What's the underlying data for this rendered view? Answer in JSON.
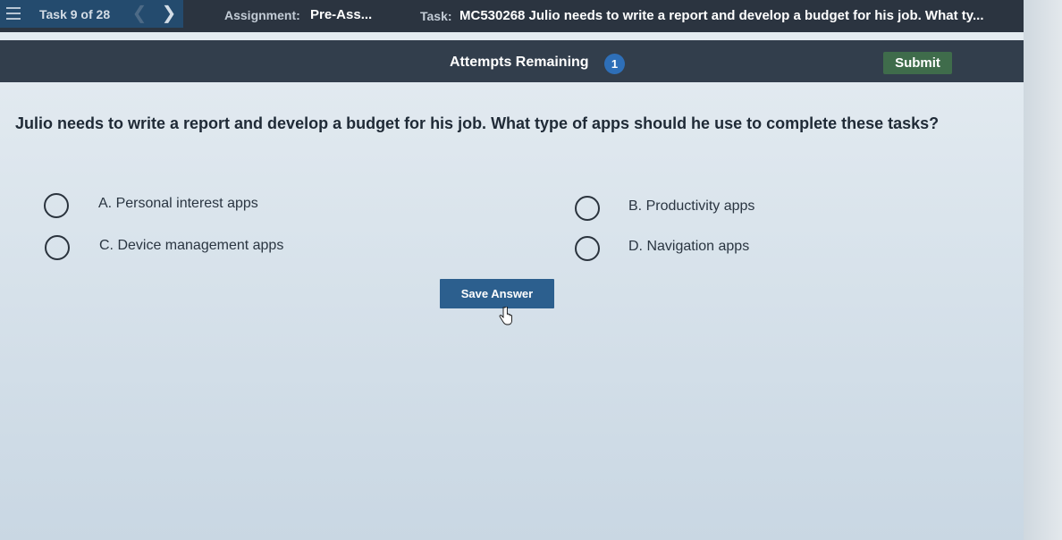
{
  "header": {
    "task_counter": "Task 9 of 28",
    "assignment_label": "Assignment:",
    "assignment_value": "Pre-Ass...",
    "task_label": "Task:",
    "task_value": "MC530268 Julio needs to write a report and develop a budget for his job. What ty...",
    "nav_prev_icon": "chevron-left-icon",
    "nav_next_icon": "chevron-right-icon",
    "menu_icon": "hamburger-menu-icon"
  },
  "attempts": {
    "label": "Attempts Remaining",
    "count": "1",
    "submit_label": "Submit"
  },
  "question": {
    "text": "Julio needs to write a report and develop a budget for his job. What type of apps should he use to complete these tasks?",
    "options": [
      {
        "label": "A. Personal interest apps",
        "selected": false
      },
      {
        "label": "B. Productivity apps",
        "selected": false
      },
      {
        "label": "C. Device management apps",
        "selected": false
      },
      {
        "label": "D. Navigation apps",
        "selected": false
      }
    ]
  },
  "actions": {
    "save_label": "Save Answer"
  },
  "colors": {
    "header_bg": "#2b3440",
    "task_nav_bg": "#244b6e",
    "attempts_bg": "#323e4c",
    "badge": "#2e6fb8",
    "submit": "#3f6c4b",
    "save": "#2c5f8e"
  }
}
